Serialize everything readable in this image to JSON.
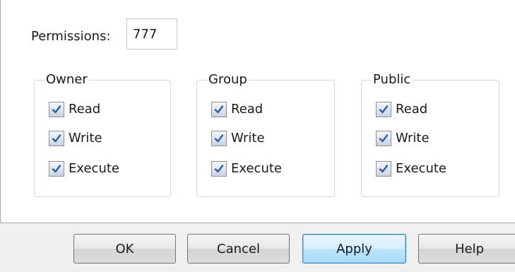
{
  "permissions": {
    "label": "Permissions:",
    "value": "777"
  },
  "groups": [
    {
      "title": "Owner",
      "checks": [
        {
          "label": "Read",
          "checked": true
        },
        {
          "label": "Write",
          "checked": true
        },
        {
          "label": "Execute",
          "checked": true
        }
      ]
    },
    {
      "title": "Group",
      "checks": [
        {
          "label": "Read",
          "checked": true
        },
        {
          "label": "Write",
          "checked": true
        },
        {
          "label": "Execute",
          "checked": true
        }
      ]
    },
    {
      "title": "Public",
      "checks": [
        {
          "label": "Read",
          "checked": true
        },
        {
          "label": "Write",
          "checked": true
        },
        {
          "label": "Execute",
          "checked": true
        }
      ]
    }
  ],
  "buttons": {
    "ok": "OK",
    "cancel": "Cancel",
    "apply": "Apply",
    "help": "Help"
  },
  "colors": {
    "checkmark": "#2a5fa8",
    "default_button_border": "#3c7fb1"
  }
}
